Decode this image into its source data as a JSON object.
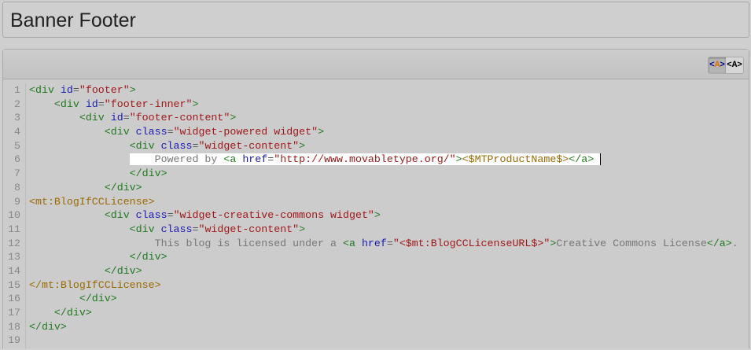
{
  "page_title": "Banner Footer",
  "toolbar": {
    "highlight_on_label": "<A>",
    "highlight_off_label": "<A>"
  },
  "highlighted_line": 6,
  "lines": [
    {
      "n": "1",
      "indent": "",
      "tokens": [
        [
          "t",
          "<div "
        ],
        [
          "a",
          "id"
        ],
        [
          "p",
          "="
        ],
        [
          "v",
          "\"footer\""
        ],
        [
          "t",
          ">"
        ]
      ]
    },
    {
      "n": "2",
      "indent": "    ",
      "tokens": [
        [
          "t",
          "<div "
        ],
        [
          "a",
          "id"
        ],
        [
          "p",
          "="
        ],
        [
          "v",
          "\"footer-inner\""
        ],
        [
          "t",
          ">"
        ]
      ]
    },
    {
      "n": "3",
      "indent": "        ",
      "tokens": [
        [
          "t",
          "<div "
        ],
        [
          "a",
          "id"
        ],
        [
          "p",
          "="
        ],
        [
          "v",
          "\"footer-content\""
        ],
        [
          "t",
          ">"
        ]
      ]
    },
    {
      "n": "4",
      "indent": "            ",
      "tokens": [
        [
          "t",
          "<div "
        ],
        [
          "a",
          "class"
        ],
        [
          "p",
          "="
        ],
        [
          "v",
          "\"widget-powered widget\""
        ],
        [
          "t",
          ">"
        ]
      ]
    },
    {
      "n": "5",
      "indent": "                ",
      "tokens": [
        [
          "t",
          "<div "
        ],
        [
          "a",
          "class"
        ],
        [
          "p",
          "="
        ],
        [
          "v",
          "\"widget-content\""
        ],
        [
          "t",
          ">"
        ]
      ]
    },
    {
      "n": "6",
      "indent": "                ",
      "tokens": [
        [
          "x",
          "    Powered by "
        ],
        [
          "t",
          "<a "
        ],
        [
          "a",
          "href"
        ],
        [
          "p",
          "="
        ],
        [
          "v",
          "\"http://www.movabletype.org/\""
        ],
        [
          "t",
          ">"
        ],
        [
          "m",
          "<$MTProductName$>"
        ],
        [
          "t",
          "</a>"
        ]
      ]
    },
    {
      "n": "7",
      "indent": "                ",
      "tokens": [
        [
          "t",
          "</div>"
        ]
      ]
    },
    {
      "n": "8",
      "indent": "            ",
      "tokens": [
        [
          "t",
          "</div>"
        ]
      ]
    },
    {
      "n": "9",
      "indent": "",
      "tokens": [
        [
          "m",
          "<mt:BlogIfCCLicense>"
        ]
      ]
    },
    {
      "n": "10",
      "indent": "            ",
      "tokens": [
        [
          "t",
          "<div "
        ],
        [
          "a",
          "class"
        ],
        [
          "p",
          "="
        ],
        [
          "v",
          "\"widget-creative-commons widget\""
        ],
        [
          "t",
          ">"
        ]
      ]
    },
    {
      "n": "11",
      "indent": "                ",
      "tokens": [
        [
          "t",
          "<div "
        ],
        [
          "a",
          "class"
        ],
        [
          "p",
          "="
        ],
        [
          "v",
          "\"widget-content\""
        ],
        [
          "t",
          ">"
        ]
      ]
    },
    {
      "n": "12",
      "indent": "                    ",
      "tokens": [
        [
          "x",
          "This blog is licensed under a "
        ],
        [
          "t",
          "<a "
        ],
        [
          "a",
          "href"
        ],
        [
          "p",
          "="
        ],
        [
          "v",
          "\"<$mt:BlogCCLicenseURL$>\""
        ],
        [
          "t",
          ">"
        ],
        [
          "x",
          "Creative Commons License"
        ],
        [
          "t",
          "</a>"
        ],
        [
          "x",
          "."
        ]
      ]
    },
    {
      "n": "13",
      "indent": "                ",
      "tokens": [
        [
          "t",
          "</div>"
        ]
      ]
    },
    {
      "n": "14",
      "indent": "            ",
      "tokens": [
        [
          "t",
          "</div>"
        ]
      ]
    },
    {
      "n": "15",
      "indent": "",
      "tokens": [
        [
          "m",
          "</mt:BlogIfCCLicense>"
        ]
      ]
    },
    {
      "n": "16",
      "indent": "        ",
      "tokens": [
        [
          "t",
          "</div>"
        ]
      ]
    },
    {
      "n": "17",
      "indent": "    ",
      "tokens": [
        [
          "t",
          "</div>"
        ]
      ]
    },
    {
      "n": "18",
      "indent": "",
      "tokens": [
        [
          "t",
          "</div>"
        ]
      ]
    },
    {
      "n": "19",
      "indent": "",
      "tokens": []
    }
  ]
}
